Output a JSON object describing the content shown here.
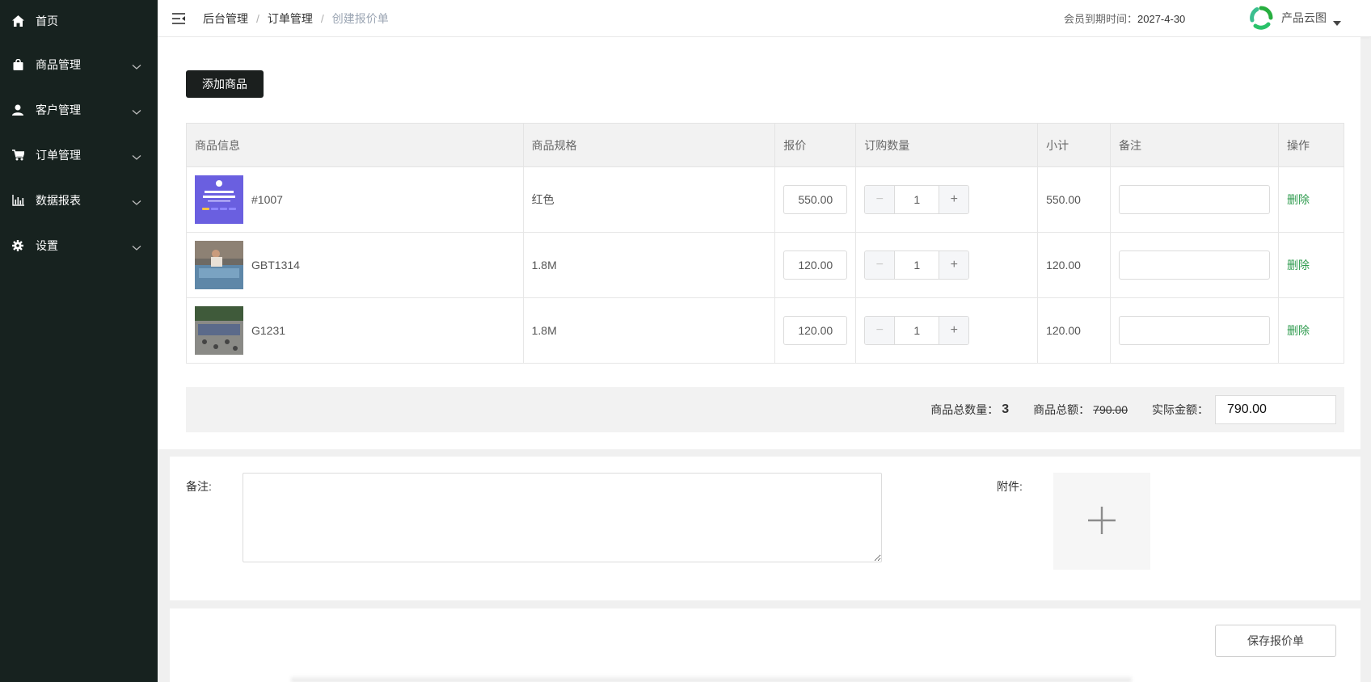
{
  "sidebar": {
    "items": [
      {
        "label": "首页",
        "icon": "home-icon"
      },
      {
        "label": "商品管理",
        "icon": "bag-icon"
      },
      {
        "label": "客户管理",
        "icon": "user-icon"
      },
      {
        "label": "订单管理",
        "icon": "cart-icon"
      },
      {
        "label": "数据报表",
        "icon": "chart-icon"
      },
      {
        "label": "设置",
        "icon": "gear-icon"
      }
    ]
  },
  "header": {
    "breadcrumb": [
      "后台管理",
      "订单管理",
      "创建报价单"
    ],
    "separator": "/",
    "member_label": "会员到期时间：",
    "member_date": "2027-4-30",
    "user_name": "产品云图"
  },
  "toolbar": {
    "add_label": "添加商品"
  },
  "table": {
    "headers": [
      "商品信息",
      "商品规格",
      "报价",
      "订购数量",
      "小计",
      "备注",
      "操作"
    ],
    "rows": [
      {
        "product": "#1007",
        "spec": "红色",
        "price": "550.00",
        "qty": "1",
        "subtotal": "550.00",
        "note": "",
        "action": "删除"
      },
      {
        "product": "GBT1314",
        "spec": "1.8M",
        "price": "120.00",
        "qty": "1",
        "subtotal": "120.00",
        "note": "",
        "action": "删除"
      },
      {
        "product": "G1231",
        "spec": "1.8M",
        "price": "120.00",
        "qty": "1",
        "subtotal": "120.00",
        "note": "",
        "action": "删除"
      }
    ]
  },
  "summary": {
    "total_qty_label": "商品总数量：",
    "total_qty": "3",
    "total_amount_label": "商品总额：",
    "total_amount": "790.00",
    "actual_label": "实际金额：",
    "actual_value": "790.00"
  },
  "form": {
    "remark_label": "备注:",
    "attachment_label": "附件:"
  },
  "footer": {
    "save_label": "保存报价单"
  },
  "colors": {
    "sidebar_bg": "#17221f",
    "accent_green": "#2e9b4e",
    "button_dark": "#1b1f1e"
  }
}
